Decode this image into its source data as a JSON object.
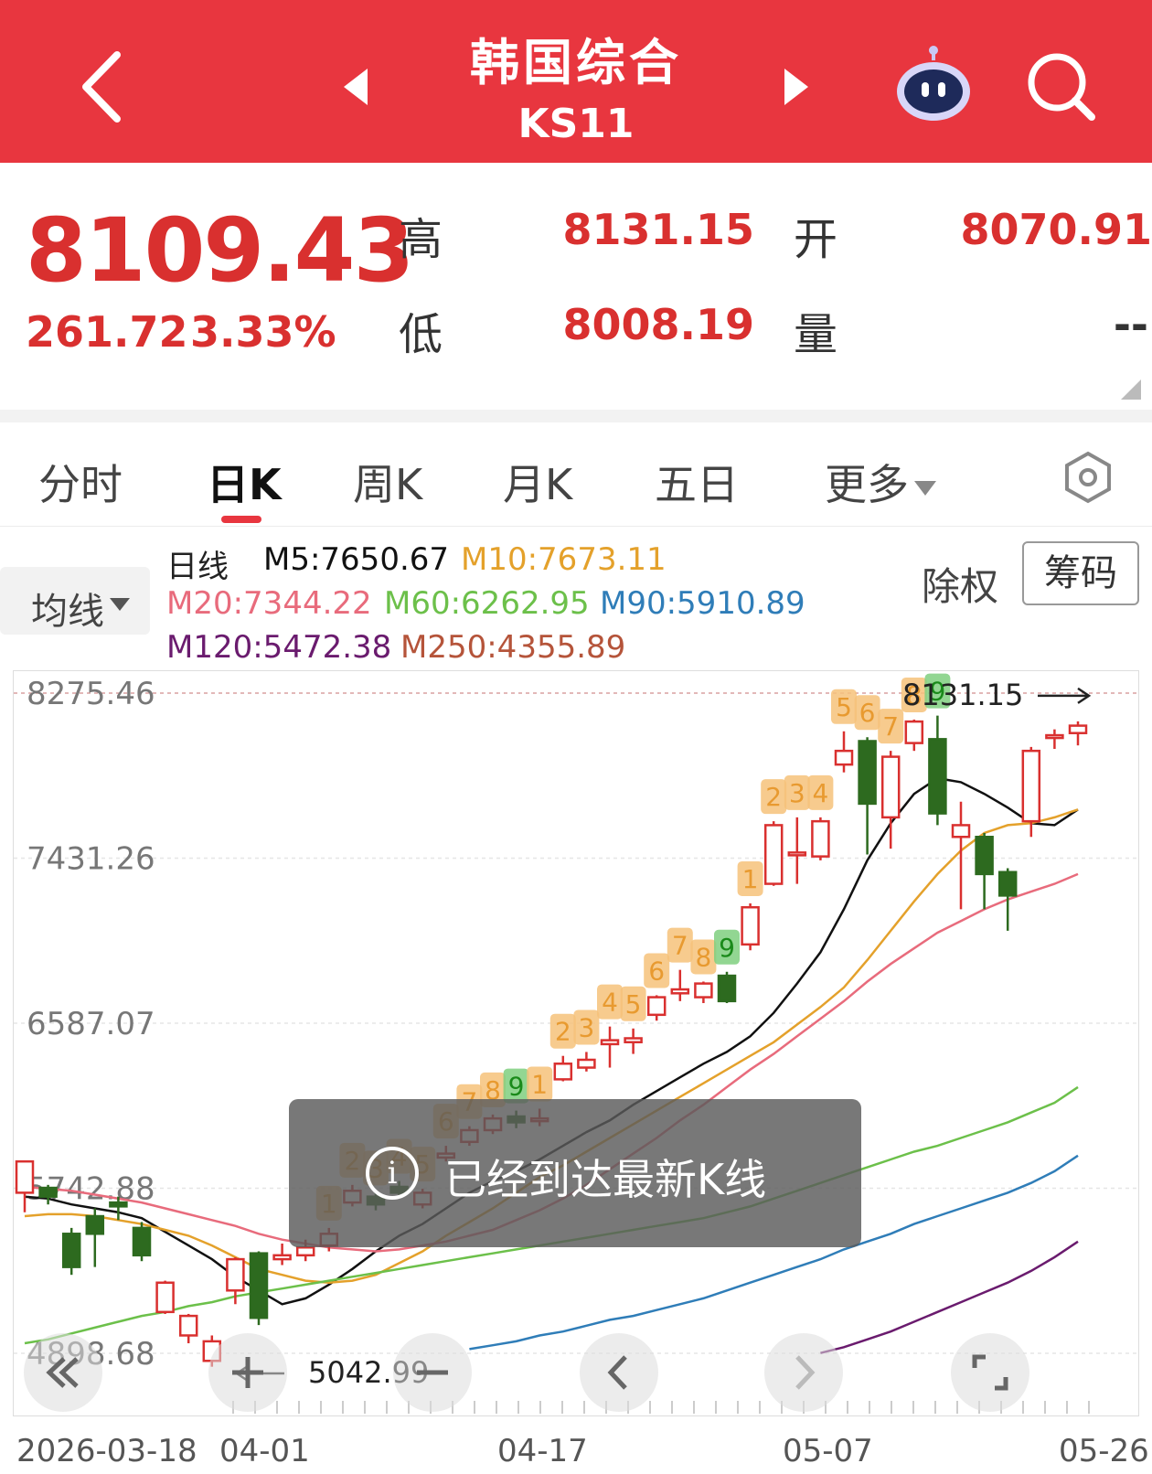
{
  "header": {
    "title": "韩国综合",
    "code": "KS11"
  },
  "quote": {
    "price": "8109.43",
    "change": "261.72",
    "change_pct": "3.33%",
    "high_label": "高",
    "high": "8131.15",
    "open_label": "开",
    "open": "8070.91",
    "low_label": "低",
    "low": "8008.19",
    "volume_label": "量",
    "volume": "--",
    "color_up": "#d9302f"
  },
  "tabs": {
    "items": [
      "分时",
      "日K",
      "周K",
      "月K",
      "五日",
      "更多"
    ],
    "active": "日K"
  },
  "ma": {
    "selector_label": "均线",
    "period_label": "日线",
    "items": [
      {
        "label": "M5:7650.67",
        "color": "#111111"
      },
      {
        "label": "M10:7673.11",
        "color": "#e4a12b"
      },
      {
        "label": "M20:7344.22",
        "color": "#e86b7c"
      },
      {
        "label": "M60:6262.95",
        "color": "#6cc04a"
      },
      {
        "label": "M90:5910.89",
        "color": "#2f7db8"
      },
      {
        "label": "M120:5472.38",
        "color": "#6a1b6e"
      },
      {
        "label": "M250:4355.89",
        "color": "#b5543a"
      }
    ],
    "exright_label": "除权",
    "chips_label": "筹码"
  },
  "chart_data": {
    "type": "candlestick",
    "y_ticks": [
      "8275.46",
      "7431.26",
      "6587.07",
      "5742.88",
      "4898.68"
    ],
    "ylim": [
      4898.68,
      8275.46
    ],
    "x_labels": [
      "2026-03-18",
      "04-01",
      "04-17",
      "05-07",
      "05-26"
    ],
    "max_annotation": "8131.15",
    "min_annotation": "5042.99",
    "colors": {
      "up": "#d9302f",
      "down": "#2d6a1f",
      "td_up": "#f6c27a",
      "td_down": "#7fcf7f"
    },
    "candles": [
      {
        "o": 5720,
        "c": 5880,
        "h": 5885,
        "l": 5620
      },
      {
        "o": 5745,
        "c": 5700,
        "h": 5760,
        "l": 5660
      },
      {
        "o": 5510,
        "c": 5340,
        "h": 5540,
        "l": 5300
      },
      {
        "o": 5600,
        "c": 5510,
        "h": 5640,
        "l": 5340
      },
      {
        "o": 5670,
        "c": 5650,
        "h": 5700,
        "l": 5580
      },
      {
        "o": 5540,
        "c": 5400,
        "h": 5570,
        "l": 5370
      },
      {
        "o": 5110,
        "c": 5260,
        "h": 5270,
        "l": 5100
      },
      {
        "o": 4990,
        "c": 5090,
        "h": 5100,
        "l": 4950
      },
      {
        "o": 4860,
        "c": 4960,
        "h": 4990,
        "l": 4830
      },
      {
        "o": 5220,
        "c": 5380,
        "h": 5390,
        "l": 5150
      },
      {
        "o": 5410,
        "c": 5080,
        "h": 5420,
        "l": 5043
      },
      {
        "o": 5380,
        "c": 5400,
        "h": 5460,
        "l": 5350
      },
      {
        "o": 5400,
        "c": 5440,
        "h": 5480,
        "l": 5370
      },
      {
        "o": 5450,
        "c": 5510,
        "h": 5540,
        "l": 5420
      },
      {
        "o": 5670,
        "c": 5730,
        "h": 5760,
        "l": 5650
      },
      {
        "o": 5700,
        "c": 5660,
        "h": 5720,
        "l": 5630
      },
      {
        "o": 5750,
        "c": 5720,
        "h": 5780,
        "l": 5690
      },
      {
        "o": 5660,
        "c": 5720,
        "h": 5740,
        "l": 5640
      },
      {
        "o": 5900,
        "c": 5920,
        "h": 5960,
        "l": 5880
      },
      {
        "o": 5980,
        "c": 6040,
        "h": 6060,
        "l": 5960
      },
      {
        "o": 6040,
        "c": 6100,
        "h": 6120,
        "l": 6020
      },
      {
        "o": 6110,
        "c": 6080,
        "h": 6140,
        "l": 6050
      },
      {
        "o": 6090,
        "c": 6100,
        "h": 6150,
        "l": 6060
      },
      {
        "o": 6300,
        "c": 6380,
        "h": 6420,
        "l": 6290
      },
      {
        "o": 6360,
        "c": 6400,
        "h": 6440,
        "l": 6340
      },
      {
        "o": 6480,
        "c": 6500,
        "h": 6570,
        "l": 6360
      },
      {
        "o": 6490,
        "c": 6510,
        "h": 6560,
        "l": 6430
      },
      {
        "o": 6630,
        "c": 6720,
        "h": 6730,
        "l": 6600
      },
      {
        "o": 6740,
        "c": 6760,
        "h": 6860,
        "l": 6700
      },
      {
        "o": 6720,
        "c": 6790,
        "h": 6800,
        "l": 6690
      },
      {
        "o": 6830,
        "c": 6700,
        "h": 6850,
        "l": 6690
      },
      {
        "o": 6990,
        "c": 7180,
        "h": 7200,
        "l": 6960
      },
      {
        "o": 7300,
        "c": 7600,
        "h": 7620,
        "l": 7290
      },
      {
        "o": 7450,
        "c": 7460,
        "h": 7640,
        "l": 7300
      },
      {
        "o": 7440,
        "c": 7620,
        "h": 7640,
        "l": 7420
      },
      {
        "o": 7910,
        "c": 7980,
        "h": 8080,
        "l": 7870
      },
      {
        "o": 8030,
        "c": 7710,
        "h": 8050,
        "l": 7450
      },
      {
        "o": 7640,
        "c": 7950,
        "h": 7980,
        "l": 7480
      },
      {
        "o": 8020,
        "c": 8130,
        "h": 8140,
        "l": 7980
      },
      {
        "o": 8040,
        "c": 7660,
        "h": 8160,
        "l": 7600
      },
      {
        "o": 7540,
        "c": 7600,
        "h": 7720,
        "l": 7170
      },
      {
        "o": 7540,
        "c": 7350,
        "h": 7560,
        "l": 7170
      },
      {
        "o": 7360,
        "c": 7240,
        "h": 7380,
        "l": 7060
      },
      {
        "o": 7620,
        "c": 7980,
        "h": 8000,
        "l": 7540
      },
      {
        "o": 8050,
        "c": 8060,
        "h": 8090,
        "l": 7990
      },
      {
        "o": 8071,
        "c": 8109,
        "h": 8131,
        "l": 8008
      }
    ],
    "td_marks": [
      {
        "idx": 13,
        "label": "1",
        "kind": "up"
      },
      {
        "idx": 14,
        "label": "2",
        "kind": "up"
      },
      {
        "idx": 15,
        "label": "3",
        "kind": "up"
      },
      {
        "idx": 16,
        "label": "4",
        "kind": "up"
      },
      {
        "idx": 17,
        "label": "5",
        "kind": "up"
      },
      {
        "idx": 18,
        "label": "6",
        "kind": "up"
      },
      {
        "idx": 19,
        "label": "7",
        "kind": "up"
      },
      {
        "idx": 20,
        "label": "8",
        "kind": "up"
      },
      {
        "idx": 21,
        "label": "9",
        "kind": "down"
      },
      {
        "idx": 22,
        "label": "1",
        "kind": "up"
      },
      {
        "idx": 23,
        "label": "2",
        "kind": "up"
      },
      {
        "idx": 24,
        "label": "3",
        "kind": "up"
      },
      {
        "idx": 25,
        "label": "4",
        "kind": "up"
      },
      {
        "idx": 26,
        "label": "5",
        "kind": "up"
      },
      {
        "idx": 27,
        "label": "6",
        "kind": "up"
      },
      {
        "idx": 28,
        "label": "7",
        "kind": "up"
      },
      {
        "idx": 29,
        "label": "8",
        "kind": "up"
      },
      {
        "idx": 30,
        "label": "9",
        "kind": "down"
      },
      {
        "idx": 31,
        "label": "1",
        "kind": "up"
      },
      {
        "idx": 32,
        "label": "2",
        "kind": "up"
      },
      {
        "idx": 33,
        "label": "3",
        "kind": "up"
      },
      {
        "idx": 34,
        "label": "4",
        "kind": "up"
      },
      {
        "idx": 35,
        "label": "5",
        "kind": "up"
      },
      {
        "idx": 36,
        "label": "6",
        "kind": "up"
      },
      {
        "idx": 37,
        "label": "7",
        "kind": "up"
      },
      {
        "idx": 38,
        "label": "8",
        "kind": "up"
      },
      {
        "idx": 39,
        "label": "9",
        "kind": "down"
      }
    ],
    "ma_lines": [
      {
        "name": "M5",
        "color": "#111111",
        "values": [
          5700,
          5690,
          5660,
          5640,
          5620,
          5590,
          5520,
          5450,
          5380,
          5290,
          5220,
          5150,
          5180,
          5250,
          5330,
          5420,
          5500,
          5560,
          5640,
          5720,
          5780,
          5830,
          5890,
          5960,
          6030,
          6090,
          6170,
          6240,
          6310,
          6380,
          6440,
          6520,
          6640,
          6790,
          6950,
          7170,
          7420,
          7610,
          7760,
          7840,
          7820,
          7760,
          7690,
          7610,
          7600,
          7680
        ]
      },
      {
        "name": "M10",
        "color": "#e4a12b",
        "values": [
          5600,
          5610,
          5610,
          5600,
          5580,
          5560,
          5530,
          5500,
          5450,
          5390,
          5330,
          5300,
          5270,
          5260,
          5270,
          5300,
          5360,
          5420,
          5500,
          5570,
          5640,
          5720,
          5800,
          5860,
          5930,
          6000,
          6070,
          6140,
          6210,
          6280,
          6350,
          6420,
          6490,
          6580,
          6670,
          6770,
          6910,
          7060,
          7210,
          7350,
          7470,
          7560,
          7600,
          7610,
          7640,
          7680
        ]
      },
      {
        "name": "M20",
        "color": "#e86b7c",
        "values": [
          5750,
          5740,
          5730,
          5710,
          5690,
          5670,
          5640,
          5610,
          5580,
          5550,
          5510,
          5480,
          5460,
          5440,
          5430,
          5420,
          5430,
          5450,
          5470,
          5500,
          5530,
          5580,
          5630,
          5690,
          5760,
          5840,
          5920,
          6000,
          6090,
          6170,
          6260,
          6350,
          6430,
          6520,
          6610,
          6700,
          6800,
          6890,
          6970,
          7050,
          7110,
          7170,
          7220,
          7260,
          7300,
          7350
        ]
      },
      {
        "name": "M60",
        "color": "#6cc04a",
        "values": [
          4950,
          4970,
          5000,
          5030,
          5060,
          5090,
          5110,
          5140,
          5160,
          5190,
          5210,
          5230,
          5250,
          5270,
          5290,
          5310,
          5330,
          5350,
          5370,
          5390,
          5410,
          5430,
          5450,
          5470,
          5490,
          5510,
          5530,
          5550,
          5570,
          5590,
          5620,
          5650,
          5690,
          5730,
          5770,
          5810,
          5850,
          5890,
          5930,
          5960,
          6000,
          6040,
          6080,
          6130,
          6180,
          6260
        ]
      },
      {
        "name": "M90",
        "color": "#2f7db8",
        "values": [
          null,
          null,
          null,
          null,
          null,
          null,
          null,
          null,
          null,
          null,
          null,
          null,
          null,
          null,
          null,
          null,
          null,
          null,
          null,
          4920,
          4940,
          4960,
          4990,
          5010,
          5040,
          5070,
          5090,
          5120,
          5150,
          5180,
          5220,
          5260,
          5300,
          5340,
          5380,
          5430,
          5470,
          5510,
          5560,
          5600,
          5640,
          5680,
          5720,
          5770,
          5830,
          5910
        ]
      },
      {
        "name": "M120",
        "color": "#6a1b6e",
        "values": [
          null,
          null,
          null,
          null,
          null,
          null,
          null,
          null,
          null,
          null,
          null,
          null,
          null,
          null,
          null,
          null,
          null,
          null,
          null,
          null,
          null,
          null,
          null,
          null,
          null,
          null,
          null,
          null,
          null,
          null,
          null,
          null,
          null,
          null,
          4900,
          4930,
          4970,
          5010,
          5060,
          5110,
          5160,
          5210,
          5260,
          5320,
          5390,
          5470
        ]
      }
    ]
  },
  "toast": {
    "icon": "i",
    "message": "已经到达最新K线"
  },
  "controls": [
    "rewind-icon",
    "zoom-in-icon",
    "zoom-out-icon",
    "prev-icon",
    "next-icon",
    "fullscreen-icon"
  ]
}
